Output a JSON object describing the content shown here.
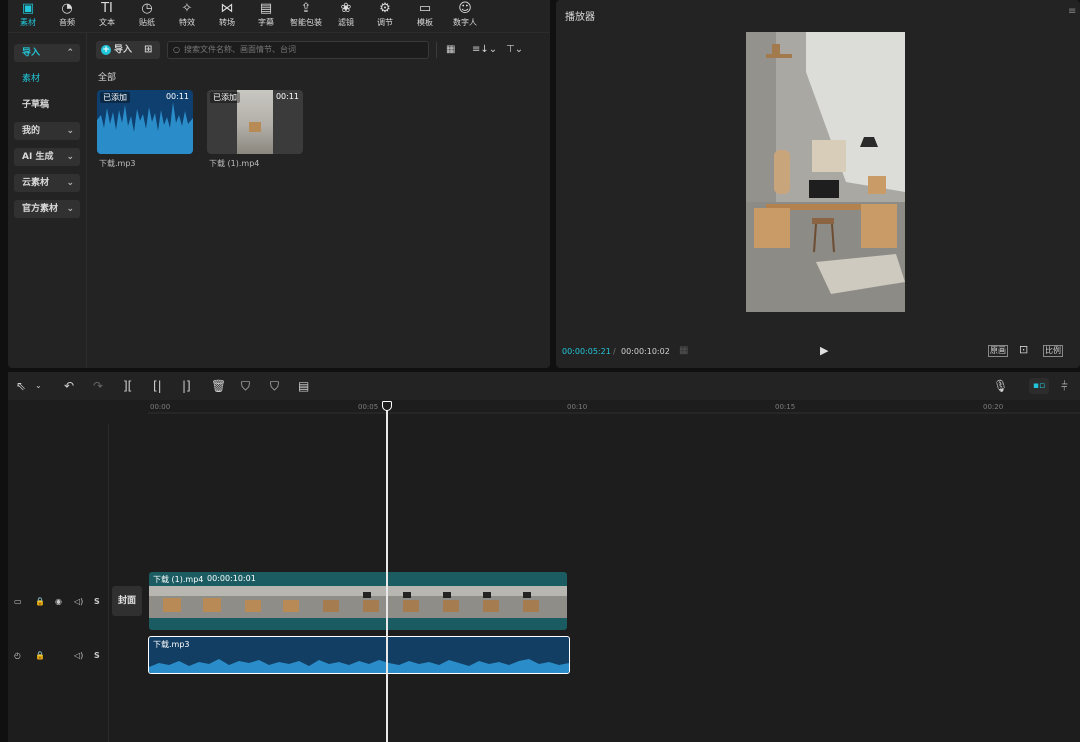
{
  "toolbar": {
    "items": [
      {
        "label": "素材",
        "icon": "media-icon"
      },
      {
        "label": "音频",
        "icon": "audio-icon"
      },
      {
        "label": "文本",
        "icon": "text-icon"
      },
      {
        "label": "贴纸",
        "icon": "sticker-icon"
      },
      {
        "label": "特效",
        "icon": "effects-icon"
      },
      {
        "label": "转场",
        "icon": "transition-icon"
      },
      {
        "label": "字幕",
        "icon": "subtitle-icon"
      },
      {
        "label": "智能包装",
        "icon": "smart-package-icon"
      },
      {
        "label": "滤镜",
        "icon": "filter-icon"
      },
      {
        "label": "调节",
        "icon": "adjust-icon"
      },
      {
        "label": "模板",
        "icon": "template-icon"
      },
      {
        "label": "数字人",
        "icon": "digital-human-icon"
      }
    ],
    "active_color": "#21c7d9"
  },
  "sidenav": {
    "items": [
      {
        "label": "导入"
      },
      {
        "label": "素材"
      },
      {
        "label": "子草稿"
      },
      {
        "label": "我的"
      },
      {
        "label": "AI 生成"
      },
      {
        "label": "云素材"
      },
      {
        "label": "官方素材"
      }
    ]
  },
  "media": {
    "import_label": "导入",
    "search_placeholder": "搜索文件名称、画面情节、台词",
    "section_label": "全部",
    "items": [
      {
        "name": "下载.mp3",
        "badge": "已添加",
        "duration": "00:11"
      },
      {
        "name": "下载 (1).mp4",
        "badge": "已添加",
        "duration": "00:11"
      }
    ]
  },
  "player": {
    "title": "播放器",
    "current_time": "00:00:05:21",
    "separator": "/",
    "total_time": "00:00:10:02",
    "btn_original": "原画",
    "btn_ratio": "比例"
  },
  "timeline": {
    "ruler": [
      "00:00",
      "00:05",
      "00:10",
      "00:15",
      "00:20"
    ],
    "video_clip": {
      "name": "下载 (1).mp4",
      "duration": "00:00:10:01"
    },
    "audio_clip": {
      "name": "下载.mp3"
    },
    "cover_label": "封面",
    "track_s": "S"
  }
}
